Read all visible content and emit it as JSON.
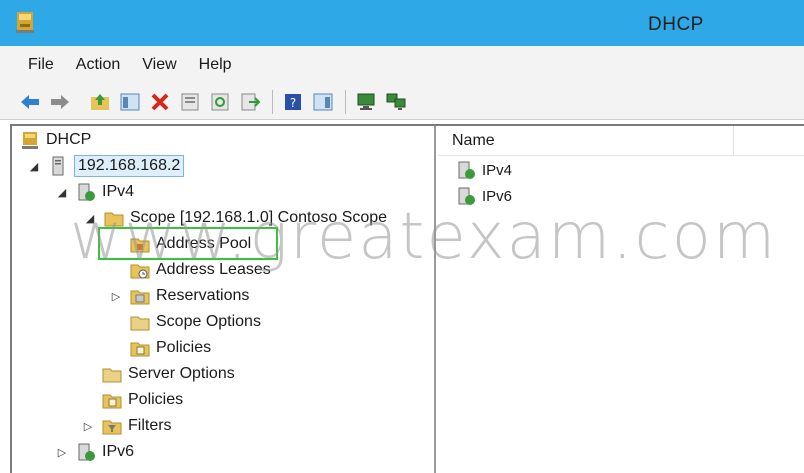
{
  "window": {
    "title": "DHCP"
  },
  "menu": {
    "file": "File",
    "action": "Action",
    "view": "View",
    "help": "Help"
  },
  "toolbar": {
    "icons": [
      "back-arrow-icon",
      "forward-arrow-icon",
      "up-folder-icon",
      "show-hide-tree-icon",
      "delete-icon",
      "properties-icon",
      "refresh-icon",
      "export-list-icon",
      "help-icon",
      "action-pane-icon",
      "computer-icon",
      "computer-network-icon"
    ],
    "delete_color": "#d8261c",
    "arrow_color": "#2f7fd4"
  },
  "tree": {
    "root": "DHCP",
    "server": "192.168.168.2",
    "ipv4": "IPv4",
    "scope": "Scope [192.168.1.0] Contoso Scope",
    "address_pool": "Address Pool",
    "address_leases": "Address Leases",
    "reservations": "Reservations",
    "scope_options": "Scope Options",
    "scope_policies": "Policies",
    "server_options": "Server Options",
    "policies": "Policies",
    "filters": "Filters",
    "ipv6": "IPv6"
  },
  "list": {
    "column_name": "Name",
    "items": [
      "IPv4",
      "IPv6"
    ]
  },
  "watermark": "www.greatexam.com",
  "colors": {
    "titlebar": "#2ea8e6",
    "highlight": "#39c23f",
    "selection": "#7fb2e5"
  }
}
